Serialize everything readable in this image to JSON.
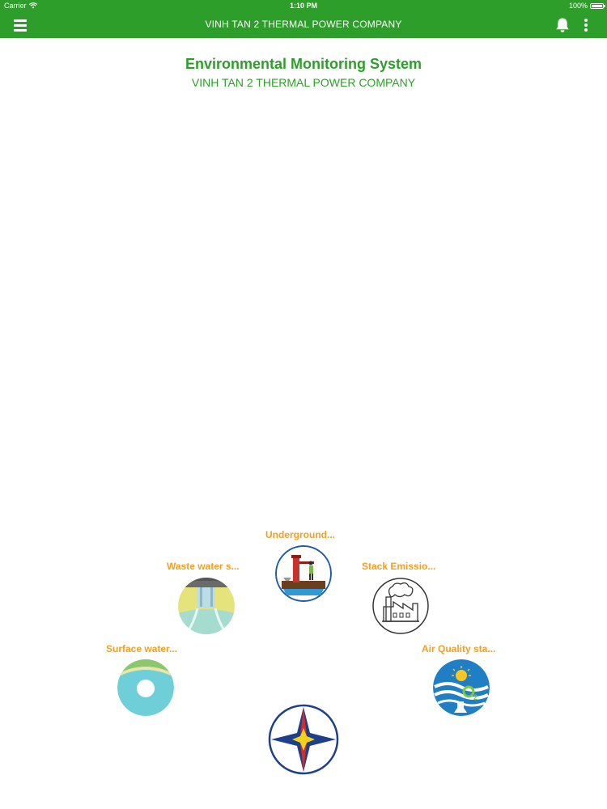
{
  "status_bar": {
    "carrier": "Carrier",
    "time": "1:10 PM",
    "battery": "100%"
  },
  "nav": {
    "title": "VINH TAN 2 THERMAL POWER COMPANY",
    "menu_icon": "hamburger-menu-icon",
    "bell_icon": "bell-icon",
    "more_icon": "more-vertical-icon"
  },
  "header": {
    "title": "Environmental Monitoring System",
    "subtitle": "VINH TAN 2 THERMAL POWER COMPANY"
  },
  "stations": [
    {
      "label": "Underground...",
      "icon": "underground-water-icon"
    },
    {
      "label": "Waste water s...",
      "icon": "waste-water-icon"
    },
    {
      "label": "Stack Emissio...",
      "icon": "factory-smoke-icon"
    },
    {
      "label": "Surface water...",
      "icon": "surface-water-icon"
    },
    {
      "label": "Air Quality sta...",
      "icon": "air-quality-icon"
    }
  ],
  "colors": {
    "brand_green": "#2e9e2a",
    "label_orange": "#f2a023"
  }
}
